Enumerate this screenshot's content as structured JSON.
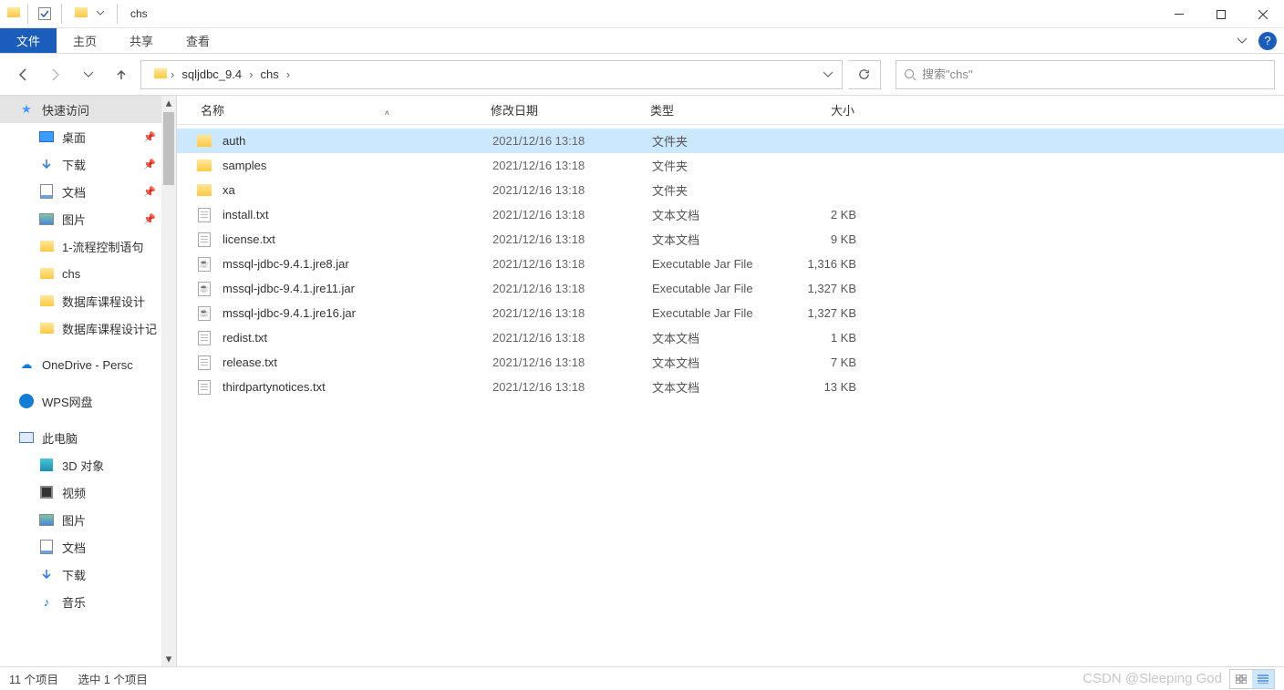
{
  "window": {
    "title": "chs"
  },
  "ribbon": {
    "file": "文件",
    "tabs": [
      "主页",
      "共享",
      "查看"
    ]
  },
  "breadcrumb": {
    "items": [
      "sqljdbc_9.4",
      "chs"
    ]
  },
  "search": {
    "placeholder": "搜索\"chs\""
  },
  "tree": {
    "quick_access": {
      "label": "快速访问"
    },
    "qa_children": [
      {
        "key": "desktop",
        "label": "桌面",
        "pinned": true,
        "icon": "desktop"
      },
      {
        "key": "downloads",
        "label": "下载",
        "pinned": true,
        "icon": "down"
      },
      {
        "key": "docs",
        "label": "文档",
        "pinned": true,
        "icon": "doc"
      },
      {
        "key": "pics",
        "label": "图片",
        "pinned": true,
        "icon": "pic"
      },
      {
        "key": "flow",
        "label": "1-流程控制语句",
        "pinned": false,
        "icon": "folder"
      },
      {
        "key": "chs",
        "label": "chs",
        "pinned": false,
        "icon": "folder"
      },
      {
        "key": "db1",
        "label": "数据库课程设计",
        "pinned": false,
        "icon": "folder"
      },
      {
        "key": "db2",
        "label": "数据库课程设计记",
        "pinned": false,
        "icon": "folder"
      }
    ],
    "onedrive": {
      "label": "OneDrive - Persc"
    },
    "wps": {
      "label": "WPS网盘"
    },
    "this_pc": {
      "label": "此电脑"
    },
    "pc_children": [
      {
        "key": "3d",
        "label": "3D 对象",
        "icon": "3d"
      },
      {
        "key": "video",
        "label": "视频",
        "icon": "vid"
      },
      {
        "key": "pics2",
        "label": "图片",
        "icon": "pic"
      },
      {
        "key": "docs2",
        "label": "文档",
        "icon": "doc"
      },
      {
        "key": "down2",
        "label": "下载",
        "icon": "down"
      },
      {
        "key": "music",
        "label": "音乐",
        "icon": "music"
      }
    ]
  },
  "columns": {
    "name": "名称",
    "date": "修改日期",
    "type": "类型",
    "size": "大小"
  },
  "types": {
    "folder": "文件夹",
    "text": "文本文档",
    "jar": "Executable Jar File"
  },
  "date_common": "2021/12/16 13:18",
  "files": [
    {
      "name": "auth",
      "typeKey": "folder",
      "size": "",
      "icon": "folder",
      "selected": true
    },
    {
      "name": "samples",
      "typeKey": "folder",
      "size": "",
      "icon": "folder"
    },
    {
      "name": "xa",
      "typeKey": "folder",
      "size": "",
      "icon": "folder"
    },
    {
      "name": "install.txt",
      "typeKey": "text",
      "size": "2 KB",
      "icon": "text"
    },
    {
      "name": "license.txt",
      "typeKey": "text",
      "size": "9 KB",
      "icon": "text"
    },
    {
      "name": "mssql-jdbc-9.4.1.jre8.jar",
      "typeKey": "jar",
      "size": "1,316 KB",
      "icon": "jar"
    },
    {
      "name": "mssql-jdbc-9.4.1.jre11.jar",
      "typeKey": "jar",
      "size": "1,327 KB",
      "icon": "jar"
    },
    {
      "name": "mssql-jdbc-9.4.1.jre16.jar",
      "typeKey": "jar",
      "size": "1,327 KB",
      "icon": "jar"
    },
    {
      "name": "redist.txt",
      "typeKey": "text",
      "size": "1 KB",
      "icon": "text"
    },
    {
      "name": "release.txt",
      "typeKey": "text",
      "size": "7 KB",
      "icon": "text"
    },
    {
      "name": "thirdpartynotices.txt",
      "typeKey": "text",
      "size": "13 KB",
      "icon": "text"
    }
  ],
  "status": {
    "count": "11 个项目",
    "selected": "选中 1 个项目"
  },
  "watermark": "CSDN @Sleeping God"
}
